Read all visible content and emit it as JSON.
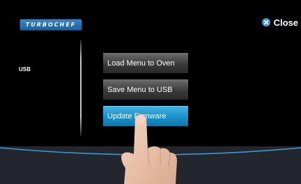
{
  "header": {
    "logo_text": "TURBOCHEF",
    "close_label": "Close"
  },
  "sidebar": {
    "items": [
      {
        "label": "USB"
      }
    ]
  },
  "menu": {
    "buttons": [
      {
        "label": "Load Menu to Oven"
      },
      {
        "label": "Save Menu to USB"
      },
      {
        "label": "Update Firmware"
      }
    ]
  },
  "colors": {
    "accent": "#1a8fc6",
    "logo_blue": "#2a72b5",
    "close_icon": "#3a98d8",
    "background": "#000000",
    "wave_line": "#3a9bd8"
  }
}
